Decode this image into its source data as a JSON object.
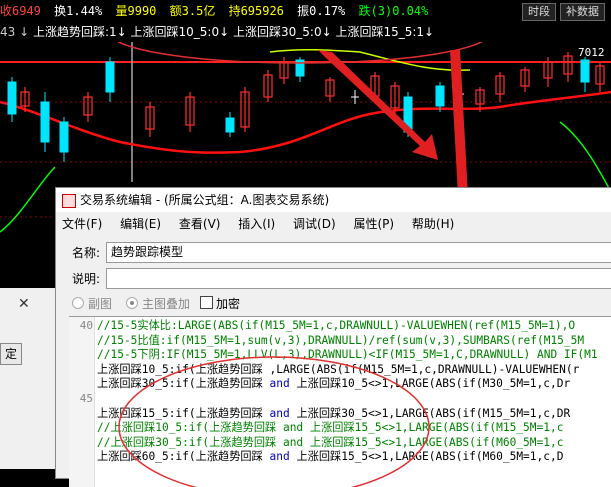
{
  "infobar": {
    "close": "收6949",
    "turnover": "换1.44%",
    "volume": "量9990",
    "amount": "额3.5亿",
    "hold": "持695926",
    "amplitude": "振0.17%",
    "fall": "跌(3)0.04%",
    "btn_time": "时段",
    "btn_supp": "补数据"
  },
  "signalbar": {
    "prefix": "43 ↓",
    "s1": "上涨趋势回踩:1↓",
    "s2": "上涨回踩10_5:0↓",
    "s3": "上涨回踩30_5:0↓",
    "s4": "上涨回踩15_5:1↓"
  },
  "chart_price_label": "7012",
  "dialog": {
    "title": "交易系统编辑 - (所属公式组：A.图表交易系统)",
    "menu": [
      "文件(F)",
      "编辑(E)",
      "查看(V)",
      "插入(I)",
      "调试(D)",
      "属性(P)",
      "帮助(H)"
    ],
    "name_label": "名称:",
    "name_value": "趋势跟踪模型",
    "desc_label": "说明:",
    "desc_value": "",
    "opt_subchart": "副图",
    "opt_mainoverlay": "主图叠加",
    "opt_encrypt": "加密"
  },
  "leftdlg": {
    "close": "✕",
    "btn": "定"
  },
  "code": {
    "line_numbers": [
      "40",
      "",
      "",
      "",
      "",
      "45",
      "",
      "",
      "",
      ""
    ],
    "lines": [
      {
        "type": "cm",
        "text": "//15-5实体比:LARGE(ABS(if(M15_5M=1,c,DRAWNULL)-VALUEWHEN(ref(M15_5M=1),O"
      },
      {
        "type": "cm",
        "text": "//15-5比值:if(M15_5M=1,sum(v,3),DRAWNULL)/ref(sum(v,3),SUMBARS(ref(M15_5M"
      },
      {
        "type": "cm",
        "text": "//15-5下阴:IF(M15_5M=1,LLV(L,3),DRAWNULL)<IF(M15_5M=1,C,DRAWNULL) AND IF(M1"
      },
      {
        "type": "mix",
        "text": "上涨回踩10_5:if(上涨趋势回踩 ,LARGE(ABS(if(M15_5M=1,c,DRAWNULL)-VALUEWHEN(r"
      },
      {
        "type": "mix",
        "text": "上涨回踩30_5:if(上涨趋势回踩 and 上涨回踩10_5<>1,LARGE(ABS(if(M30_5M=1,c,Dr"
      },
      {
        "type": "blank",
        "text": ""
      },
      {
        "type": "mix",
        "text": "上涨回踩15_5:if(上涨趋势回踩 and 上涨回踩30_5<>1,LARGE(ABS(if(M15_5M=1,c,DR"
      },
      {
        "type": "cm",
        "text": "//上涨回踩10_5:if(上涨趋势回踩 and 上涨回踩15_5<>1,LARGE(ABS(if(M15_5M=1,c"
      },
      {
        "type": "cm",
        "text": "//上涨回踩30_5:if(上涨趋势回踩 and 上涨回踩15_5<>1,LARGE(ABS(if(M60_5M=1,c"
      },
      {
        "type": "mix",
        "text": "上涨回踩60_5:if(上涨趋势回踩 and 上涨回踩15_5<>1,LARGE(ABS(if(M60_5M=1,c,D"
      }
    ]
  }
}
